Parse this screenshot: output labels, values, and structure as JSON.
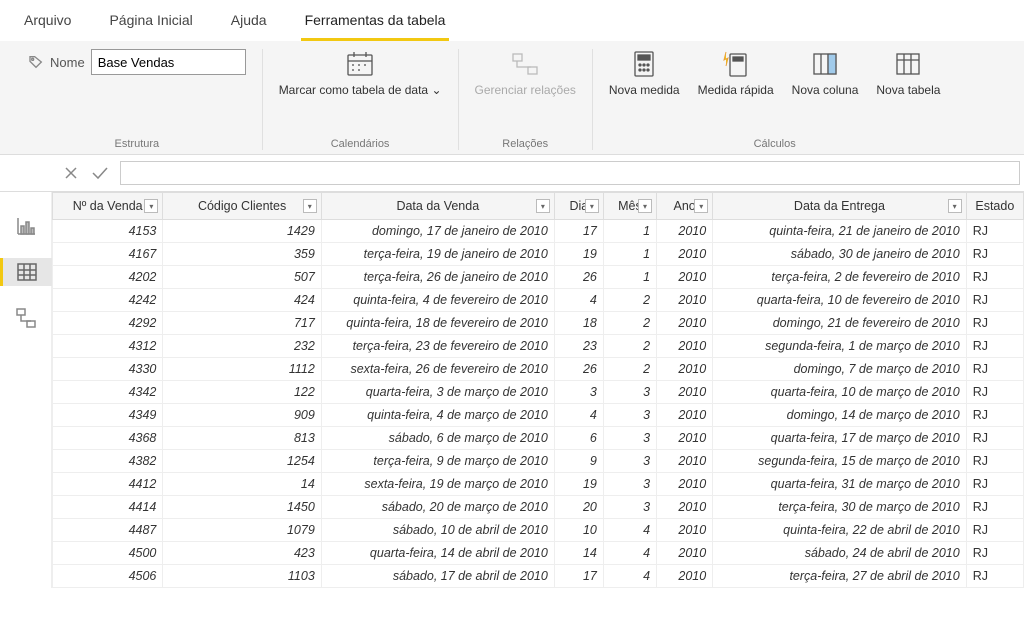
{
  "tabs": {
    "arquivo": "Arquivo",
    "pagina": "Página Inicial",
    "ajuda": "Ajuda",
    "ferramentas": "Ferramentas da tabela"
  },
  "ribbon": {
    "nome_label": "Nome",
    "nome_value": "Base Vendas",
    "estrutura_label": "Estrutura",
    "marcar": "Marcar como tabela de data ",
    "calendarios": "Calendários",
    "gerenciar": "Gerenciar relações",
    "relacoes": "Relações",
    "nova_medida": "Nova medida",
    "medida_rapida": "Medida rápida",
    "nova_coluna": "Nova coluna",
    "nova_tabela": "Nova tabela",
    "calculos": "Cálculos"
  },
  "columns": {
    "n_venda": "Nº da Venda",
    "codigo": "Código Clientes",
    "data_venda": "Data da Venda",
    "dia": "Dia",
    "mes": "Mês",
    "ano": "Ano",
    "data_entrega": "Data da Entrega",
    "estado": "Estado"
  },
  "rows": [
    {
      "nv": "4153",
      "cod": "1429",
      "dv": "domingo, 17 de janeiro de 2010",
      "dia": "17",
      "mes": "1",
      "ano": "2010",
      "de": "quinta-feira, 21 de janeiro de 2010",
      "est": "RJ"
    },
    {
      "nv": "4167",
      "cod": "359",
      "dv": "terça-feira, 19 de janeiro de 2010",
      "dia": "19",
      "mes": "1",
      "ano": "2010",
      "de": "sábado, 30 de janeiro de 2010",
      "est": "RJ"
    },
    {
      "nv": "4202",
      "cod": "507",
      "dv": "terça-feira, 26 de janeiro de 2010",
      "dia": "26",
      "mes": "1",
      "ano": "2010",
      "de": "terça-feira, 2 de fevereiro de 2010",
      "est": "RJ"
    },
    {
      "nv": "4242",
      "cod": "424",
      "dv": "quinta-feira, 4 de fevereiro de 2010",
      "dia": "4",
      "mes": "2",
      "ano": "2010",
      "de": "quarta-feira, 10 de fevereiro de 2010",
      "est": "RJ"
    },
    {
      "nv": "4292",
      "cod": "717",
      "dv": "quinta-feira, 18 de fevereiro de 2010",
      "dia": "18",
      "mes": "2",
      "ano": "2010",
      "de": "domingo, 21 de fevereiro de 2010",
      "est": "RJ"
    },
    {
      "nv": "4312",
      "cod": "232",
      "dv": "terça-feira, 23 de fevereiro de 2010",
      "dia": "23",
      "mes": "2",
      "ano": "2010",
      "de": "segunda-feira, 1 de março de 2010",
      "est": "RJ"
    },
    {
      "nv": "4330",
      "cod": "1112",
      "dv": "sexta-feira, 26 de fevereiro de 2010",
      "dia": "26",
      "mes": "2",
      "ano": "2010",
      "de": "domingo, 7 de março de 2010",
      "est": "RJ"
    },
    {
      "nv": "4342",
      "cod": "122",
      "dv": "quarta-feira, 3 de março de 2010",
      "dia": "3",
      "mes": "3",
      "ano": "2010",
      "de": "quarta-feira, 10 de março de 2010",
      "est": "RJ"
    },
    {
      "nv": "4349",
      "cod": "909",
      "dv": "quinta-feira, 4 de março de 2010",
      "dia": "4",
      "mes": "3",
      "ano": "2010",
      "de": "domingo, 14 de março de 2010",
      "est": "RJ"
    },
    {
      "nv": "4368",
      "cod": "813",
      "dv": "sábado, 6 de março de 2010",
      "dia": "6",
      "mes": "3",
      "ano": "2010",
      "de": "quarta-feira, 17 de março de 2010",
      "est": "RJ"
    },
    {
      "nv": "4382",
      "cod": "1254",
      "dv": "terça-feira, 9 de março de 2010",
      "dia": "9",
      "mes": "3",
      "ano": "2010",
      "de": "segunda-feira, 15 de março de 2010",
      "est": "RJ"
    },
    {
      "nv": "4412",
      "cod": "14",
      "dv": "sexta-feira, 19 de março de 2010",
      "dia": "19",
      "mes": "3",
      "ano": "2010",
      "de": "quarta-feira, 31 de março de 2010",
      "est": "RJ"
    },
    {
      "nv": "4414",
      "cod": "1450",
      "dv": "sábado, 20 de março de 2010",
      "dia": "20",
      "mes": "3",
      "ano": "2010",
      "de": "terça-feira, 30 de março de 2010",
      "est": "RJ"
    },
    {
      "nv": "4487",
      "cod": "1079",
      "dv": "sábado, 10 de abril de 2010",
      "dia": "10",
      "mes": "4",
      "ano": "2010",
      "de": "quinta-feira, 22 de abril de 2010",
      "est": "RJ"
    },
    {
      "nv": "4500",
      "cod": "423",
      "dv": "quarta-feira, 14 de abril de 2010",
      "dia": "14",
      "mes": "4",
      "ano": "2010",
      "de": "sábado, 24 de abril de 2010",
      "est": "RJ"
    },
    {
      "nv": "4506",
      "cod": "1103",
      "dv": "sábado, 17 de abril de 2010",
      "dia": "17",
      "mes": "4",
      "ano": "2010",
      "de": "terça-feira, 27 de abril de 2010",
      "est": "RJ"
    }
  ]
}
